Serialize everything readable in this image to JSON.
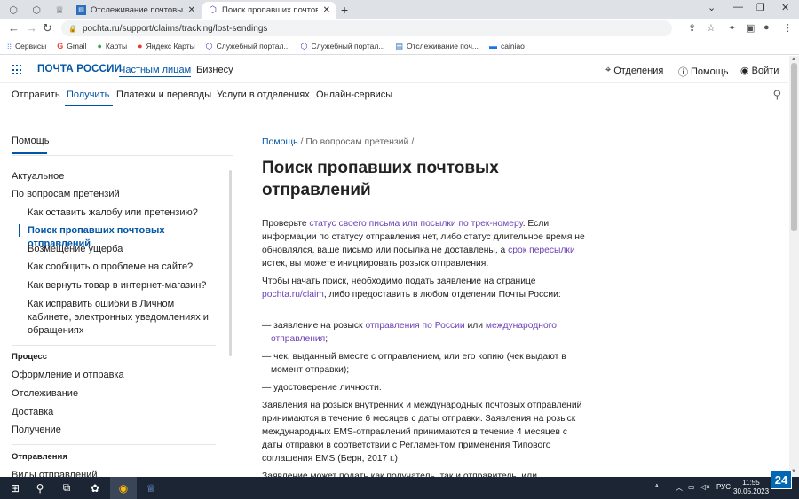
{
  "browser": {
    "tabs": [
      {
        "title": "Отслеживание почтовых отправл",
        "active": false
      },
      {
        "title": "Поиск пропавших почтовых отп",
        "active": true
      }
    ],
    "url": "pochta.ru/support/claims/tracking/lost-sendings",
    "bookmarks": [
      "Сервисы",
      "Gmail",
      "Карты",
      "Яндекс Карты",
      "Служебный портал...",
      "Служебный портал...",
      "Отслеживание поч...",
      "cainiao"
    ]
  },
  "header": {
    "logo": "ПОЧТА РОССИИ",
    "segments": [
      "Частным лицам",
      "Бизнесу"
    ],
    "utilities": [
      "Отделения",
      "Помощь",
      "Войти"
    ]
  },
  "nav": {
    "items": [
      "Отправить",
      "Получить",
      "Платежи и переводы",
      "Услуги в отделениях",
      "Онлайн-сервисы"
    ]
  },
  "sidebar": {
    "tab": "Помощь",
    "items": [
      "Актуальное",
      "По вопросам претензий"
    ],
    "sub_items": [
      "Как оставить жалобу или претензию?",
      "Поиск пропавших почтовых отправлений",
      "Возмещение ущерба",
      "Как сообщить о проблеме на сайте?",
      "Как вернуть товар в интернет-магазин?",
      "Как исправить ошибки в Личном кабинете, электронных уведомлениях и обращениях"
    ],
    "group1": "Процесс",
    "group1_items": [
      "Оформление и отправка",
      "Отслеживание",
      "Доставка",
      "Получение"
    ],
    "group2": "Отправления",
    "group2_items": [
      "Виды отправлений"
    ]
  },
  "article": {
    "breadcrumb": [
      "Помощь",
      "По вопросам претензий"
    ],
    "title": "Поиск пропавших почтовых отправлений",
    "p1": {
      "t1": "Проверьте ",
      "link1": "статус своего письма или посылки по трек-номеру",
      "t2": ". Если информации по статусу отправления нет, либо статус длительное время не обновлялся, ваше письмо или посылка не доставлены, а  ",
      "link2": "срок пересылки",
      "t3": " истек, вы можете инициировать розыск отправления."
    },
    "p2": {
      "t1": "Чтобы начать поиск, необходимо подать заявление на странице ",
      "link1": "pochta.ru/claim",
      "t2": ", либо предоставить в любом отделении Почты России:"
    },
    "list": {
      "i1_t1": "— заявление на розыск ",
      "i1_link1": "отправления по России",
      "i1_t2": " или ",
      "i1_link2": "международного отправления",
      "i1_t3": ";",
      "i2": "— чек, выданный вместе с отправлением, или его копию (чек выдают в момент отправки);",
      "i3": "— удостоверение личности."
    },
    "p3": "Заявления на розыск внутренних и международных почтовых отправлений принимаются в течение 6 месяцев с даты отправки. Заявления на розыск международных EMS-отправлений принимаются в течение 4 месяцев с даты отправки в соответствии с Регламентом применения Типового соглашения EMS (Берн, 2017 г.)",
    "p4": "Заявление может подать как получатель, так и отправитель, или"
  },
  "taskbar": {
    "lang": "РУС",
    "time": "11:55",
    "date": "30.05.2023",
    "badge": "24"
  }
}
